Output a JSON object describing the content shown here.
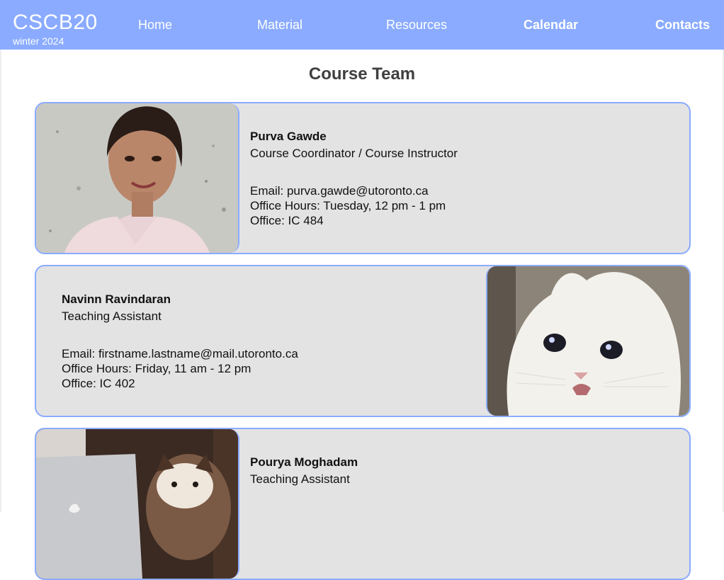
{
  "brand": {
    "name": "CSCB20",
    "term": "winter 2024"
  },
  "nav": {
    "home": "Home",
    "material": "Material",
    "resources": "Resources",
    "calendar": "Calendar",
    "contacts": "Contacts"
  },
  "page": {
    "title": "Course Team"
  },
  "team": [
    {
      "name": "Purva Gawde",
      "role": "Course Coordinator / Course Instructor",
      "email": "Email: purva.gawde@utoronto.ca",
      "hours": "Office Hours: Tuesday, 12 pm - 1 pm",
      "office": "Office: IC 484"
    },
    {
      "name": "Navinn Ravindaran",
      "role": "Teaching Assistant",
      "email": "Email: firstname.lastname@mail.utoronto.ca",
      "hours": "Office Hours: Friday, 11 am - 12 pm",
      "office": "Office: IC 402"
    },
    {
      "name": "Pourya Moghadam",
      "role": "Teaching Assistant"
    }
  ],
  "colors": {
    "nav_bg": "#8aabff",
    "card_bg": "#e3e3e3",
    "card_border": "#8aabff"
  }
}
